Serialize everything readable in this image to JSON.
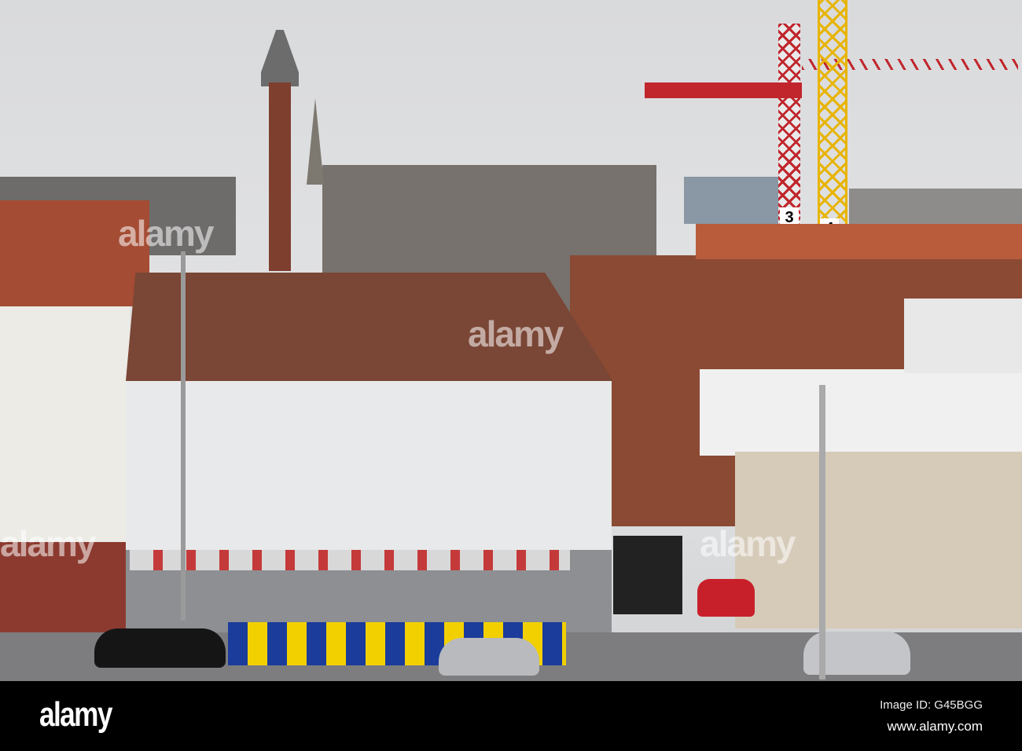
{
  "photo": {
    "crane_numbers": [
      "3",
      "4"
    ],
    "colors": {
      "sky": "#dcdcdc",
      "roof": "#7a4635",
      "brick": "#8b4a33",
      "crane_red": "#c0262c",
      "crane_yellow": "#e8b400",
      "fence_blue": "#1b3c9a",
      "fence_yellow": "#f2d000"
    }
  },
  "watermark": {
    "text": "alamy"
  },
  "footer": {
    "logo": "alamy",
    "image_id": "Image ID: G45BGG",
    "website": "www.alamy.com"
  }
}
